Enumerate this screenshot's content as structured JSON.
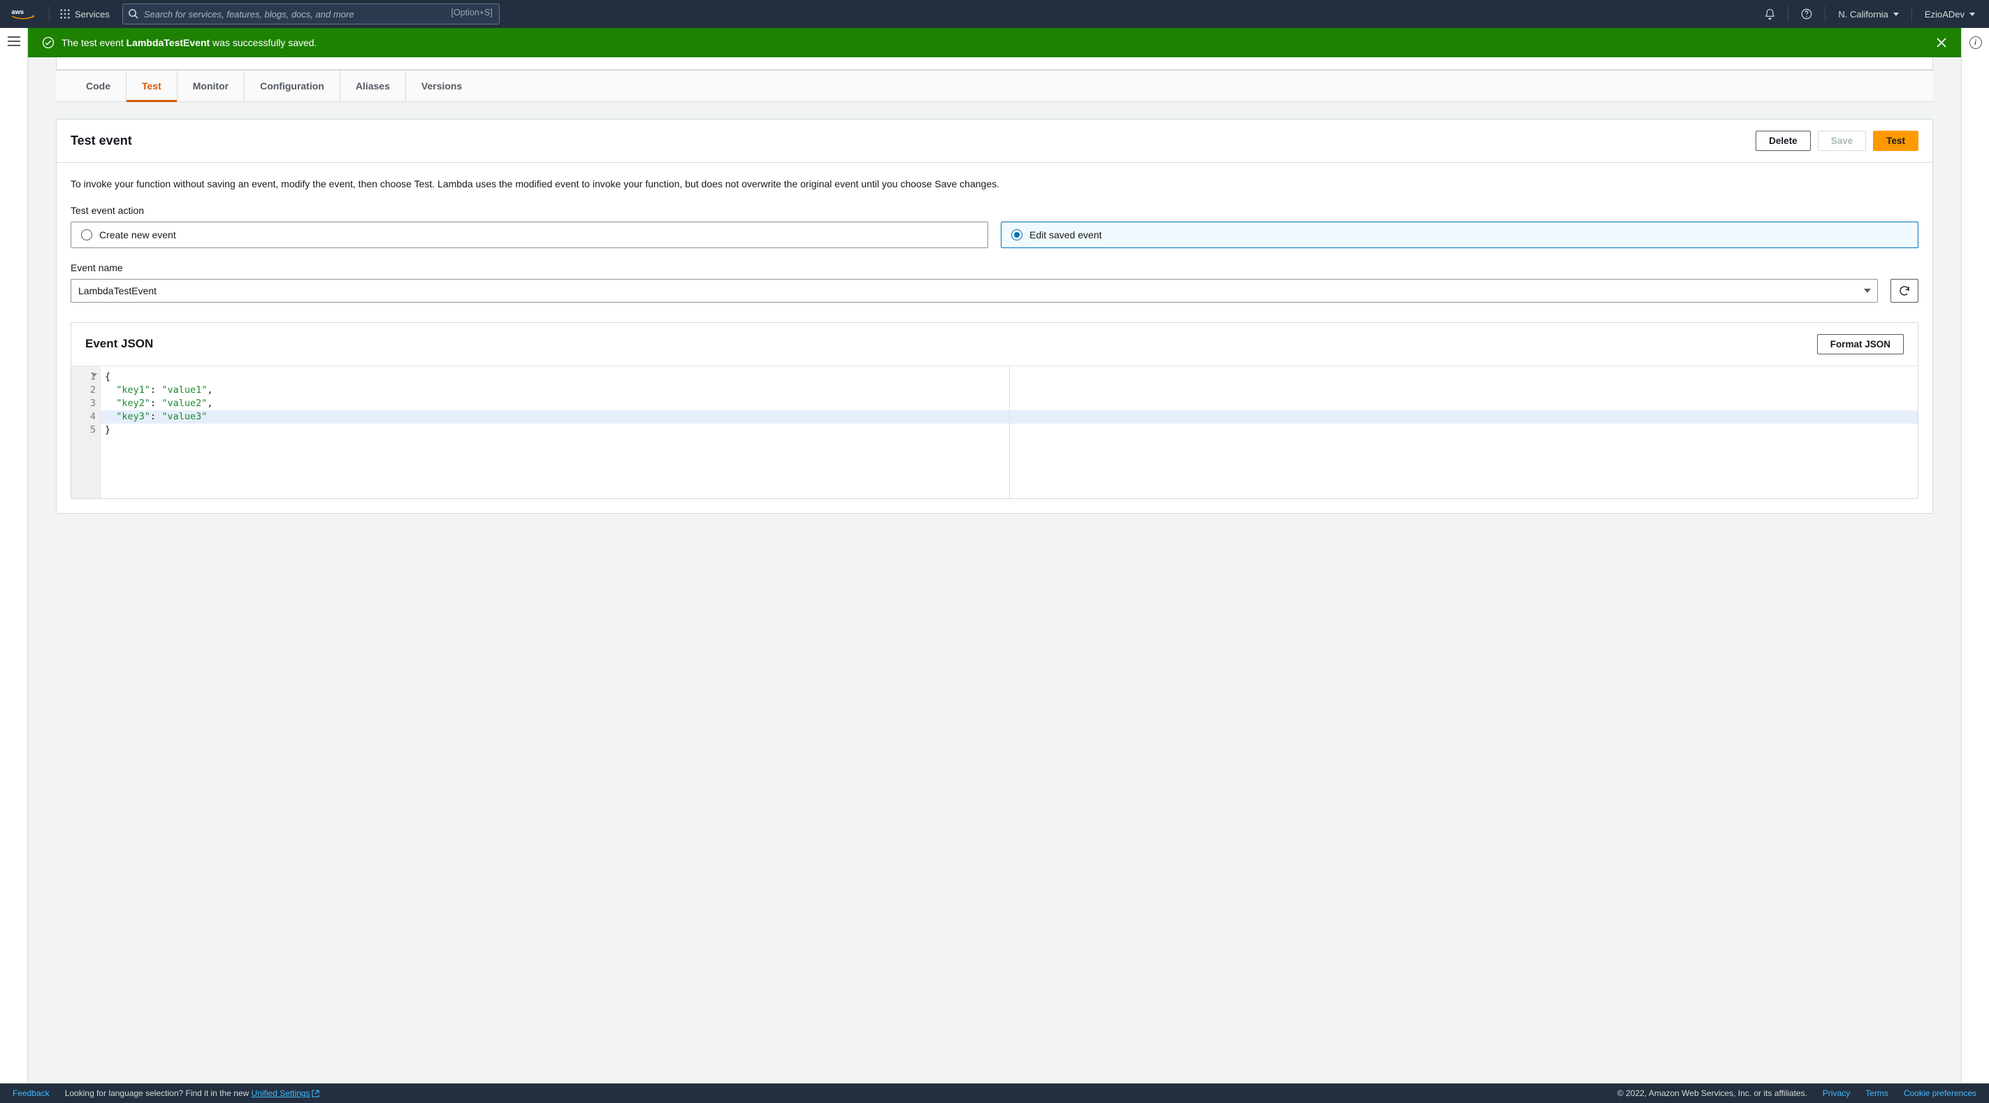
{
  "nav": {
    "services_label": "Services",
    "search_placeholder": "Search for services, features, blogs, docs, and more",
    "search_kbd": "[Option+S]",
    "region": "N. California",
    "account": "EzioADev"
  },
  "flash": {
    "prefix": "The test event ",
    "event_name": "LambdaTestEvent",
    "suffix": " was successfully saved."
  },
  "tabs": {
    "code": "Code",
    "test": "Test",
    "monitor": "Monitor",
    "configuration": "Configuration",
    "aliases": "Aliases",
    "versions": "Versions",
    "active": "test"
  },
  "panel": {
    "title": "Test event",
    "delete_label": "Delete",
    "save_label": "Save",
    "test_label": "Test",
    "description": "To invoke your function without saving an event, modify the event, then choose Test. Lambda uses the modified event to invoke your function, but does not overwrite the original event until you choose Save changes.",
    "action_label": "Test event action",
    "radio_create": "Create new event",
    "radio_edit": "Edit saved event",
    "event_name_label": "Event name",
    "event_name_value": "LambdaTestEvent"
  },
  "json_card": {
    "title": "Event JSON",
    "format_label": "Format JSON",
    "lines": [
      {
        "n": "1",
        "html": "<span class='tok-pun'>{</span>",
        "fold": true
      },
      {
        "n": "2",
        "html": "  <span class='tok-str'>\"key1\"</span><span class='tok-pun'>: </span><span class='tok-str'>\"value1\"</span><span class='tok-pun'>,</span>"
      },
      {
        "n": "3",
        "html": "  <span class='tok-str'>\"key2\"</span><span class='tok-pun'>: </span><span class='tok-str'>\"value2\"</span><span class='tok-pun'>,</span>"
      },
      {
        "n": "4",
        "html": "  <span class='tok-str'>\"key3\"</span><span class='tok-pun'>: </span><span class='tok-str'>\"value3\"</span>",
        "hl": true
      },
      {
        "n": "5",
        "html": "<span class='tok-pun'>}</span>"
      }
    ]
  },
  "footer": {
    "feedback": "Feedback",
    "lang_hint_prefix": "Looking for language selection? Find it in the new ",
    "lang_hint_link": "Unified Settings",
    "copyright": "© 2022, Amazon Web Services, Inc. or its affiliates.",
    "privacy": "Privacy",
    "terms": "Terms",
    "cookies": "Cookie preferences"
  }
}
